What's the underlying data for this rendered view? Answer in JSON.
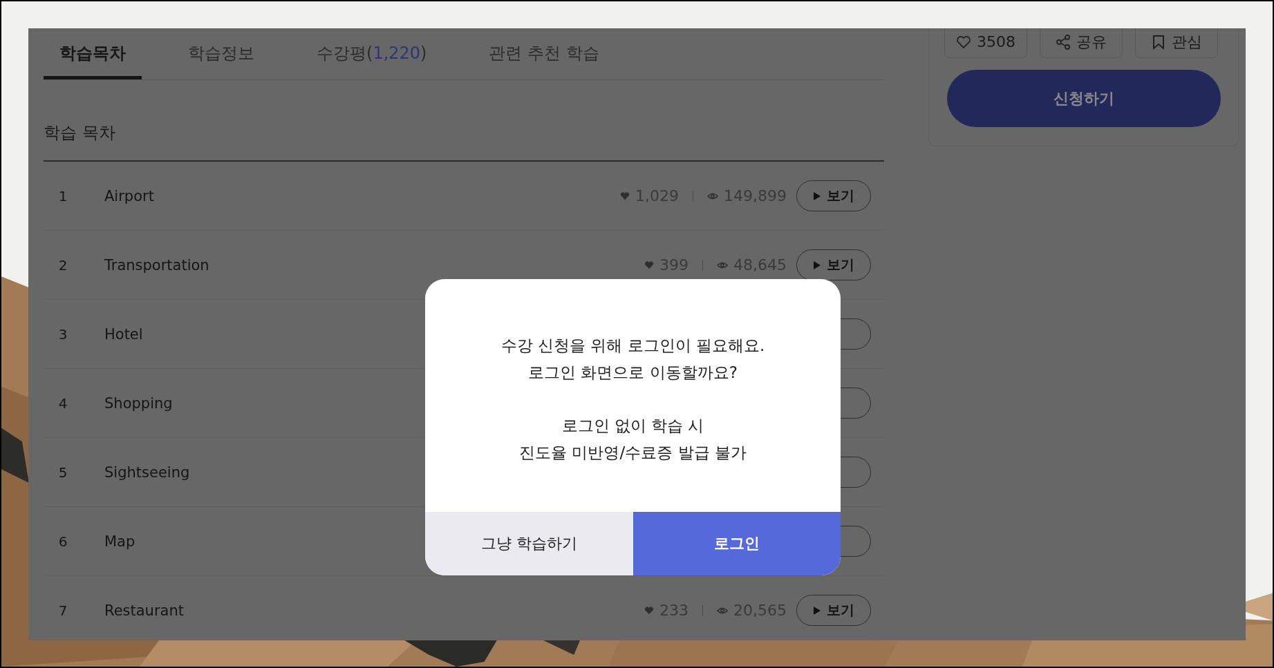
{
  "tabs": [
    {
      "label": "학습목차",
      "selected": true
    },
    {
      "label": "학습정보",
      "selected": false
    },
    {
      "label": "수강평(",
      "count": "1,220",
      "suffix": ")",
      "selected": false
    },
    {
      "label": "관련 추천 학습",
      "selected": false
    }
  ],
  "section_title": "학습 목차",
  "lessons": [
    {
      "number": "1",
      "title": "Airport",
      "likes": "1,029",
      "views": "149,899",
      "watch": "보기"
    },
    {
      "number": "2",
      "title": "Transportation",
      "likes": "399",
      "views": "48,645",
      "watch": "보기"
    },
    {
      "number": "3",
      "title": "Hotel"
    },
    {
      "number": "4",
      "title": "Shopping"
    },
    {
      "number": "5",
      "title": "Sightseeing"
    },
    {
      "number": "6",
      "title": "Map"
    },
    {
      "number": "7",
      "title": "Restaurant",
      "likes": "233",
      "views": "20,565",
      "watch": "보기"
    }
  ],
  "sidebar": {
    "actions": [
      {
        "kind": "like",
        "label": "3508"
      },
      {
        "kind": "share",
        "label": "공유"
      },
      {
        "kind": "bookmark",
        "label": "관심"
      }
    ],
    "apply_button": "신청하기"
  },
  "dialog": {
    "paragraphs": [
      [
        "수강 신청을 위해 로그인이 필요해요.",
        "로그인 화면으로 이동할까요?"
      ],
      [
        "로그인 없이 학습 시",
        "진도율 미반영/수료증 발급 불가"
      ]
    ],
    "buttons": [
      {
        "label": "그냥 학습하기",
        "kind": "secondary"
      },
      {
        "label": "로그인",
        "kind": "primary"
      }
    ]
  }
}
